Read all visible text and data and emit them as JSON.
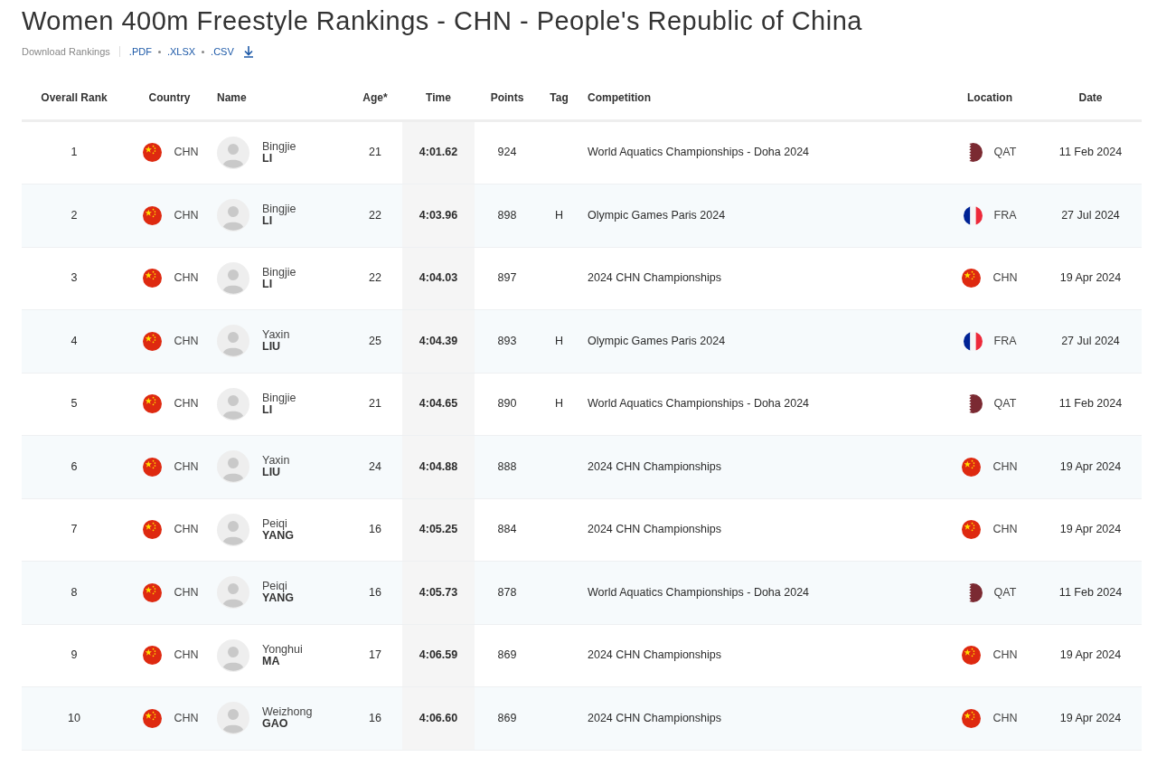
{
  "title": "Women 400m Freestyle Rankings - CHN - People's Republic of China",
  "download": {
    "label": "Download Rankings",
    "links": [
      ".PDF",
      ".XLSX",
      ".CSV"
    ]
  },
  "columns": [
    "Overall Rank",
    "Country",
    "Name",
    "Age*",
    "Time",
    "Points",
    "Tag",
    "Competition",
    "Location",
    "Date"
  ],
  "rows": [
    {
      "rank": "1",
      "country": {
        "kind": "cn",
        "code": "CHN"
      },
      "first": "Bingjie",
      "last": "LI",
      "age": "21",
      "time": "4:01.62",
      "points": "924",
      "competition": "World Aquatics Championships - Doha 2024",
      "location": {
        "kind": "qa",
        "code": "QAT"
      },
      "date": "11 Feb 2024"
    },
    {
      "rank": "2",
      "country": {
        "kind": "cn",
        "code": "CHN"
      },
      "first": "Bingjie",
      "last": "LI",
      "age": "22",
      "time": "4:03.96",
      "points": "898",
      "tag": "H",
      "competition": "Olympic Games Paris 2024",
      "location": {
        "kind": "fr",
        "code": "FRA"
      },
      "date": "27 Jul 2024"
    },
    {
      "rank": "3",
      "country": {
        "kind": "cn",
        "code": "CHN"
      },
      "first": "Bingjie",
      "last": "LI",
      "age": "22",
      "time": "4:04.03",
      "points": "897",
      "competition": "2024 CHN Championships",
      "location": {
        "kind": "cn",
        "code": "CHN"
      },
      "date": "19 Apr 2024"
    },
    {
      "rank": "4",
      "country": {
        "kind": "cn",
        "code": "CHN"
      },
      "first": "Yaxin",
      "last": "LIU",
      "age": "25",
      "time": "4:04.39",
      "points": "893",
      "tag": "H",
      "competition": "Olympic Games Paris 2024",
      "location": {
        "kind": "fr",
        "code": "FRA"
      },
      "date": "27 Jul 2024"
    },
    {
      "rank": "5",
      "country": {
        "kind": "cn",
        "code": "CHN"
      },
      "first": "Bingjie",
      "last": "LI",
      "age": "21",
      "time": "4:04.65",
      "points": "890",
      "tag": "H",
      "competition": "World Aquatics Championships - Doha 2024",
      "location": {
        "kind": "qa",
        "code": "QAT"
      },
      "date": "11 Feb 2024"
    },
    {
      "rank": "6",
      "country": {
        "kind": "cn",
        "code": "CHN"
      },
      "first": "Yaxin",
      "last": "LIU",
      "age": "24",
      "time": "4:04.88",
      "points": "888",
      "competition": "2024 CHN Championships",
      "location": {
        "kind": "cn",
        "code": "CHN"
      },
      "date": "19 Apr 2024"
    },
    {
      "rank": "7",
      "country": {
        "kind": "cn",
        "code": "CHN"
      },
      "first": "Peiqi",
      "last": "YANG",
      "age": "16",
      "time": "4:05.25",
      "points": "884",
      "competition": "2024 CHN Championships",
      "location": {
        "kind": "cn",
        "code": "CHN"
      },
      "date": "19 Apr 2024"
    },
    {
      "rank": "8",
      "country": {
        "kind": "cn",
        "code": "CHN"
      },
      "first": "Peiqi",
      "last": "YANG",
      "age": "16",
      "time": "4:05.73",
      "points": "878",
      "competition": "World Aquatics Championships - Doha 2024",
      "location": {
        "kind": "qa",
        "code": "QAT"
      },
      "date": "11 Feb 2024"
    },
    {
      "rank": "9",
      "country": {
        "kind": "cn",
        "code": "CHN"
      },
      "first": "Yonghui",
      "last": "MA",
      "age": "17",
      "time": "4:06.59",
      "points": "869",
      "competition": "2024 CHN Championships",
      "location": {
        "kind": "cn",
        "code": "CHN"
      },
      "date": "19 Apr 2024"
    },
    {
      "rank": "10",
      "country": {
        "kind": "cn",
        "code": "CHN"
      },
      "first": "Weizhong",
      "last": "GAO",
      "age": "16",
      "time": "4:06.60",
      "points": "869",
      "competition": "2024 CHN Championships",
      "location": {
        "kind": "cn",
        "code": "CHN"
      },
      "date": "19 Apr 2024"
    }
  ]
}
